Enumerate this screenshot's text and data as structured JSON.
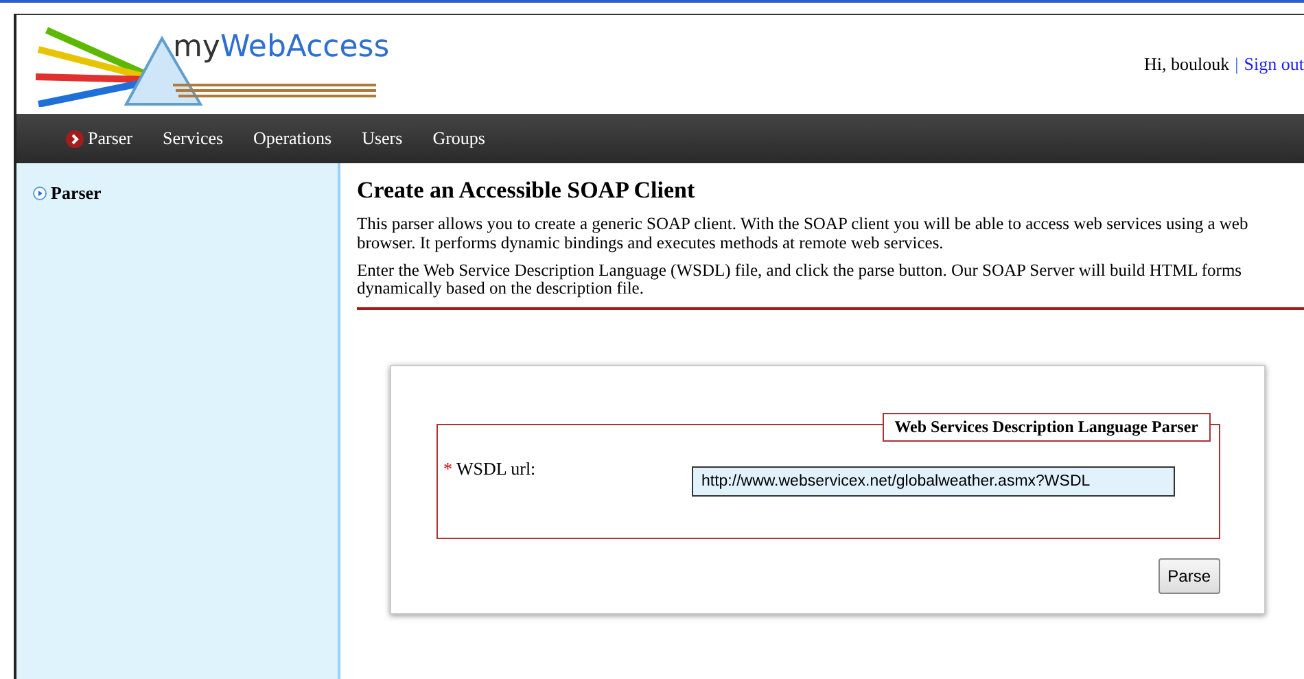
{
  "header": {
    "logo_prefix": "my",
    "logo_name": "WebAccess",
    "greeting": "Hi, boulouk",
    "separator": "|",
    "sign_out": "Sign out"
  },
  "nav": [
    {
      "label": "Parser",
      "selected": true
    },
    {
      "label": "Services",
      "selected": false
    },
    {
      "label": "Operations",
      "selected": false
    },
    {
      "label": "Users",
      "selected": false
    },
    {
      "label": "Groups",
      "selected": false
    }
  ],
  "sidebar": {
    "items": [
      {
        "label": "Parser",
        "selected": true
      }
    ]
  },
  "content": {
    "title": "Create an Accessible SOAP Client",
    "paragraphs": [
      "This parser allows you to create a generic SOAP client. With the SOAP client you will be able to access web services using a web browser. It performs dynamic bindings and executes methods at remote web services.",
      "Enter the Web Service Description Language (WSDL) file, and click the parse button. Our SOAP Server will build HTML forms dynamically based on the description file."
    ],
    "form": {
      "legend": "Web Services Description Language Parser",
      "required_mark": "*",
      "label": "WSDL url:",
      "value": "http://www.webservicex.net/globalweather.asmx?WSDL",
      "button": "Parse"
    }
  }
}
